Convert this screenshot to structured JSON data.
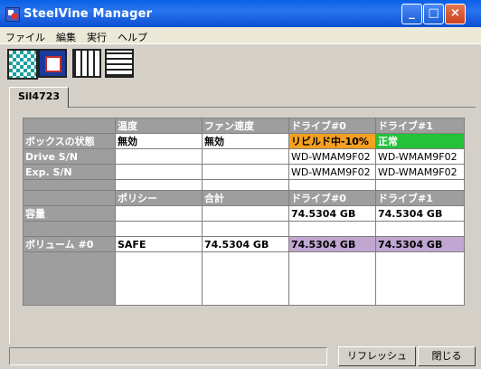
{
  "window": {
    "title": "SteelVine Manager"
  },
  "menu": [
    "ファイル",
    "編集",
    "実行",
    "ヘルプ"
  ],
  "tabs": [
    "Sil4723"
  ],
  "table1": {
    "headers": [
      "温度",
      "ファン速度",
      "ドライブ#0",
      "ドライブ#1"
    ],
    "rows": [
      {
        "label": "ボックスの状態",
        "cells": [
          "無効",
          "無効",
          "リビルド中-10%",
          "正常"
        ]
      },
      {
        "label": "Drive S/N",
        "cells": [
          "",
          "",
          "WD-WMAM9F02",
          "WD-WMAM9F02"
        ]
      },
      {
        "label": "Exp. S/N",
        "cells": [
          "",
          "",
          "WD-WMAM9F02",
          "WD-WMAM9F02"
        ]
      }
    ]
  },
  "table2": {
    "headers": [
      "ポリシー",
      "合計",
      "ドライブ#0",
      "ドライブ#1"
    ],
    "rows": [
      {
        "label": "容量",
        "cells": [
          "",
          "",
          "74.5304 GB",
          "74.5304 GB"
        ]
      },
      {
        "label": "ボリューム #0",
        "cells": [
          "SAFE",
          "74.5304 GB",
          "74.5304 GB",
          "74.5304 GB"
        ]
      }
    ]
  },
  "buttons": {
    "refresh": "リフレッシュ",
    "close": "閉じる"
  },
  "colors": {
    "rebuild": "#f5a020",
    "normal": "#23c23a",
    "volume": "#c0a6d0"
  }
}
